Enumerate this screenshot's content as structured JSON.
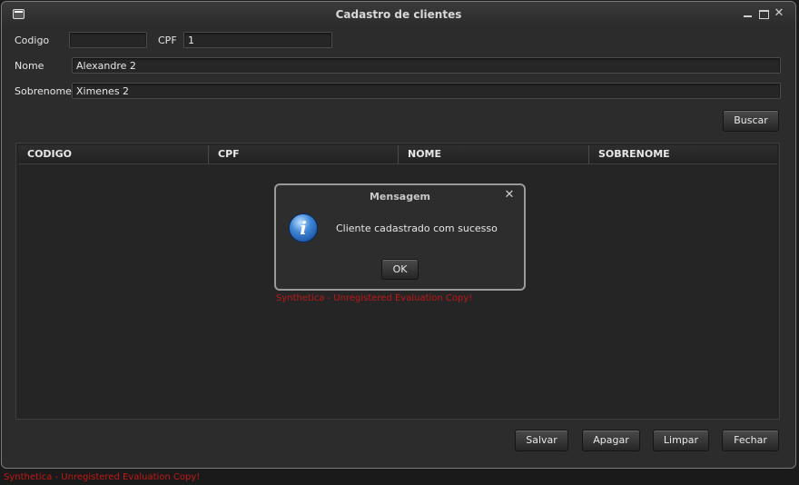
{
  "window": {
    "title": "Cadastro de clientes",
    "controls": {
      "minimize_icon": "minimize-icon",
      "maximize_icon": "maximize-icon",
      "close_glyph": "✕"
    }
  },
  "form": {
    "codigo_label": "Codigo",
    "codigo_value": "",
    "cpf_label": "CPF",
    "cpf_value": "1",
    "nome_label": "Nome",
    "nome_value": "Alexandre 2",
    "sobrenome_label": "Sobrenome",
    "sobrenome_value": "Ximenes 2",
    "buscar_label": "Buscar"
  },
  "table": {
    "columns": [
      "CODIGO",
      "CPF",
      "NOME",
      "SOBRENOME"
    ],
    "rows": []
  },
  "dialog": {
    "title": "Mensagem",
    "close_glyph": "✕",
    "icon": "info-icon",
    "icon_glyph": "i",
    "message": "Cliente cadastrado com sucesso",
    "ok_label": "OK",
    "watermark": "Synthetica - Unregistered Evaluation Copy!"
  },
  "actions": {
    "salvar": "Salvar",
    "apagar": "Apagar",
    "limpar": "Limpar",
    "fechar": "Fechar"
  },
  "footer": {
    "watermark": "Synthetica - Unregistered Evaluation Copy!"
  },
  "colors": {
    "background": "#2c2c2c",
    "watermark": "#c01818",
    "info_icon": "#3f86d6"
  }
}
